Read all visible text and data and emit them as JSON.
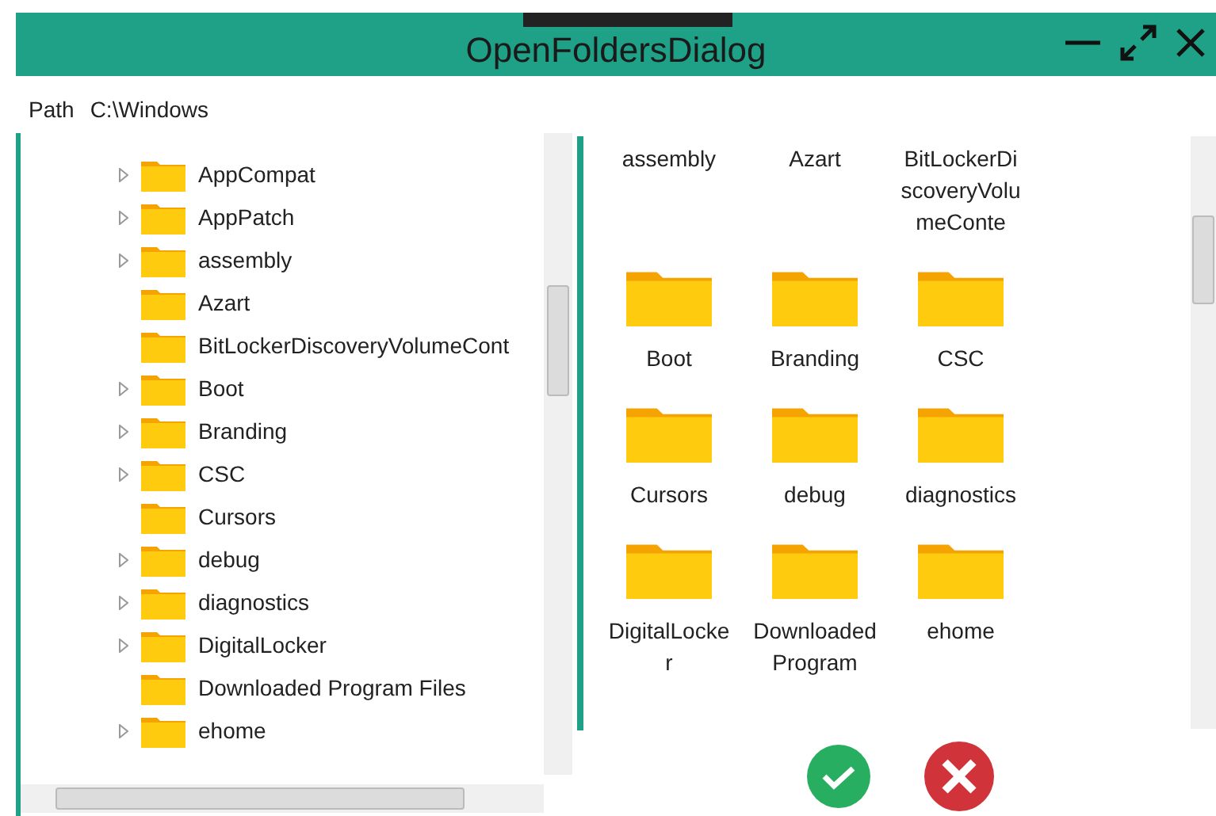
{
  "window": {
    "title": "OpenFoldersDialog"
  },
  "path": {
    "label": "Path",
    "value": "C:\\Windows"
  },
  "tree": {
    "items": [
      {
        "label": "AppCompat",
        "has_children": true
      },
      {
        "label": "AppPatch",
        "has_children": true
      },
      {
        "label": "assembly",
        "has_children": true
      },
      {
        "label": "Azart",
        "has_children": false
      },
      {
        "label": "BitLockerDiscoveryVolumeCont",
        "has_children": false
      },
      {
        "label": "Boot",
        "has_children": true
      },
      {
        "label": "Branding",
        "has_children": true
      },
      {
        "label": "CSC",
        "has_children": true
      },
      {
        "label": "Cursors",
        "has_children": false
      },
      {
        "label": "debug",
        "has_children": true
      },
      {
        "label": "diagnostics",
        "has_children": true
      },
      {
        "label": "DigitalLocker",
        "has_children": true
      },
      {
        "label": "Downloaded Program Files",
        "has_children": false
      },
      {
        "label": "ehome",
        "has_children": true
      }
    ]
  },
  "grid": {
    "items": [
      {
        "label": "assembly",
        "icon_visible": false
      },
      {
        "label": "Azart",
        "icon_visible": false
      },
      {
        "label": "BitLockerDiscoveryVolumeConte",
        "icon_visible": false
      },
      {
        "label": "Boot",
        "icon_visible": true
      },
      {
        "label": "Branding",
        "icon_visible": true
      },
      {
        "label": "CSC",
        "icon_visible": true
      },
      {
        "label": "Cursors",
        "icon_visible": true
      },
      {
        "label": "debug",
        "icon_visible": true
      },
      {
        "label": "diagnostics",
        "icon_visible": true
      },
      {
        "label": "DigitalLocker",
        "icon_visible": true
      },
      {
        "label": "Downloaded Program",
        "icon_visible": true
      },
      {
        "label": "ehome",
        "icon_visible": true
      }
    ]
  }
}
